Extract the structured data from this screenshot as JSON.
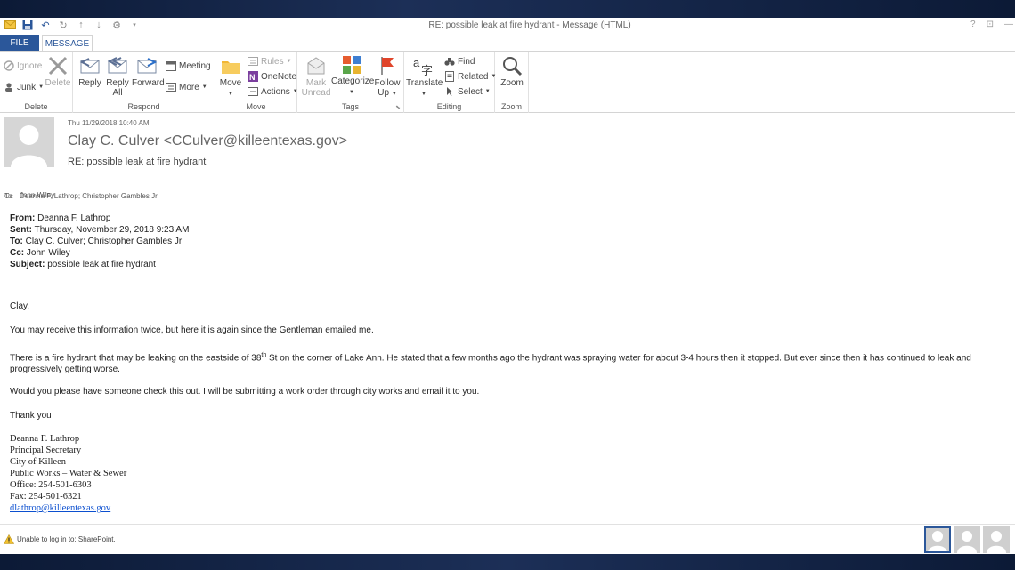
{
  "window": {
    "title": "RE: possible leak at fire hydrant - Message (HTML)",
    "help": "?",
    "restore": "⊡",
    "min": "—"
  },
  "tabs": {
    "file": "FILE",
    "message": "MESSAGE"
  },
  "ribbon": {
    "delete_group": {
      "label": "Delete",
      "ignore": "Ignore",
      "junk": "Junk",
      "delete": "Delete"
    },
    "respond_group": {
      "label": "Respond",
      "reply": "Reply",
      "reply_all_1": "Reply",
      "reply_all_2": "All",
      "forward": "Forward",
      "meeting": "Meeting",
      "more": "More"
    },
    "move_group": {
      "label": "Move",
      "move": "Move",
      "rules": "Rules",
      "onenote": "OneNote",
      "actions": "Actions"
    },
    "tags_group": {
      "label": "Tags",
      "mark_unread_1": "Mark",
      "mark_unread_2": "Unread",
      "categorize": "Categorize",
      "follow_up_1": "Follow",
      "follow_up_2": "Up"
    },
    "editing_group": {
      "label": "Editing",
      "translate": "Translate",
      "find": "Find",
      "related": "Related",
      "select": "Select"
    },
    "zoom_group": {
      "label": "Zoom",
      "zoom": "Zoom"
    }
  },
  "header": {
    "date": "Thu 11/29/2018 10:40 AM",
    "from": "Clay C. Culver <CCulver@killeentexas.gov>",
    "subject": "RE: possible leak at fire hydrant",
    "to_label": "To",
    "to": "Deanna F. Lathrop; Christopher Gambles Jr",
    "cc_label": "Cc",
    "cc": "John Wiley"
  },
  "message": {
    "from_label": "From:",
    "from": " Deanna F. Lathrop",
    "sent_label": "Sent:",
    "sent": " Thursday, November 29, 2018 9:23 AM",
    "to_label": "To:",
    "to": " Clay C. Culver; Christopher Gambles Jr",
    "cc_label": "Cc:",
    "cc": " John Wiley",
    "subject_label": "Subject:",
    "subject": " possible leak at fire hydrant",
    "greeting": "Clay,",
    "p1": "You may receive this information twice, but here it is again since the Gentleman emailed me.",
    "p2_a": "There is a fire hydrant that may be leaking on the eastside of 38",
    "p2_sup": "th",
    "p2_b": " St on the corner of Lake Ann.  He stated that a few months ago the hydrant was spraying water for about 3-4 hours then it stopped.  But ever since then it has continued to leak and progressively getting worse.",
    "p3": "Would you please have someone check this out.  I will be submitting a work order through city works and email it to you.",
    "closing": "Thank you",
    "signature": {
      "name": "Deanna F. Lathrop",
      "title": "Principal Secretary",
      "org": "City of Killeen",
      "dept": "Public Works – Water & Sewer",
      "office": "Office: 254-501-6303",
      "fax": "Fax: 254-501-6321",
      "email": "dlathrop@killeentexas.gov"
    }
  },
  "status": {
    "text": "Unable to log in to: SharePoint."
  }
}
